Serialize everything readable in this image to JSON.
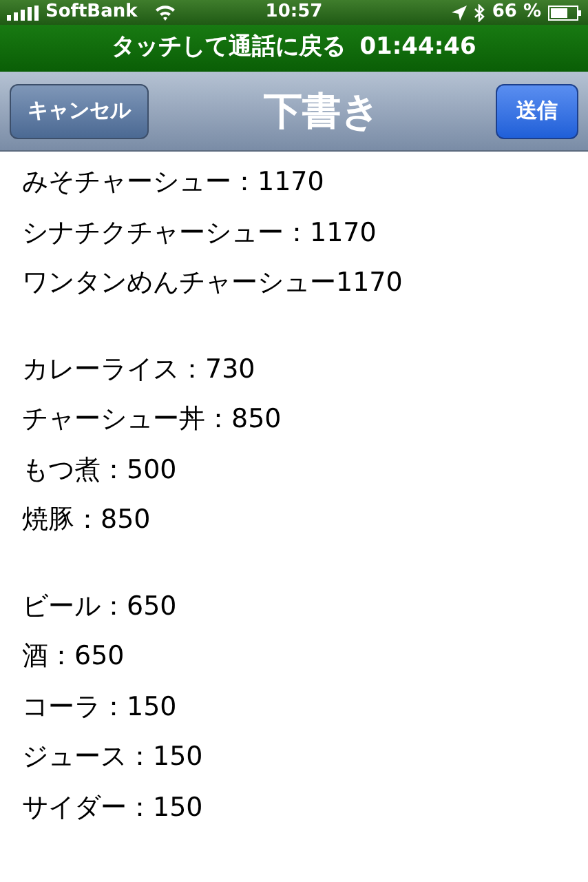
{
  "status_bar": {
    "carrier": "SoftBank",
    "time": "10:57",
    "battery": "66 %"
  },
  "call_bar": {
    "text": "タッチして通話に戻る",
    "duration": "01:44:46"
  },
  "nav_bar": {
    "cancel": "キャンセル",
    "title": "下書き",
    "send": "送信"
  },
  "note": {
    "groups": [
      [
        "みそチャーシュー：1170",
        "シナチクチャーシュー：1170",
        "ワンタンめんチャーシュー1170"
      ],
      [
        "カレーライス：730",
        "チャーシュー丼：850",
        "もつ煮：500",
        "焼豚：850"
      ],
      [
        "ビール：650",
        "酒：650",
        "コーラ：150",
        "ジュース：150",
        "サイダー：150"
      ]
    ]
  }
}
